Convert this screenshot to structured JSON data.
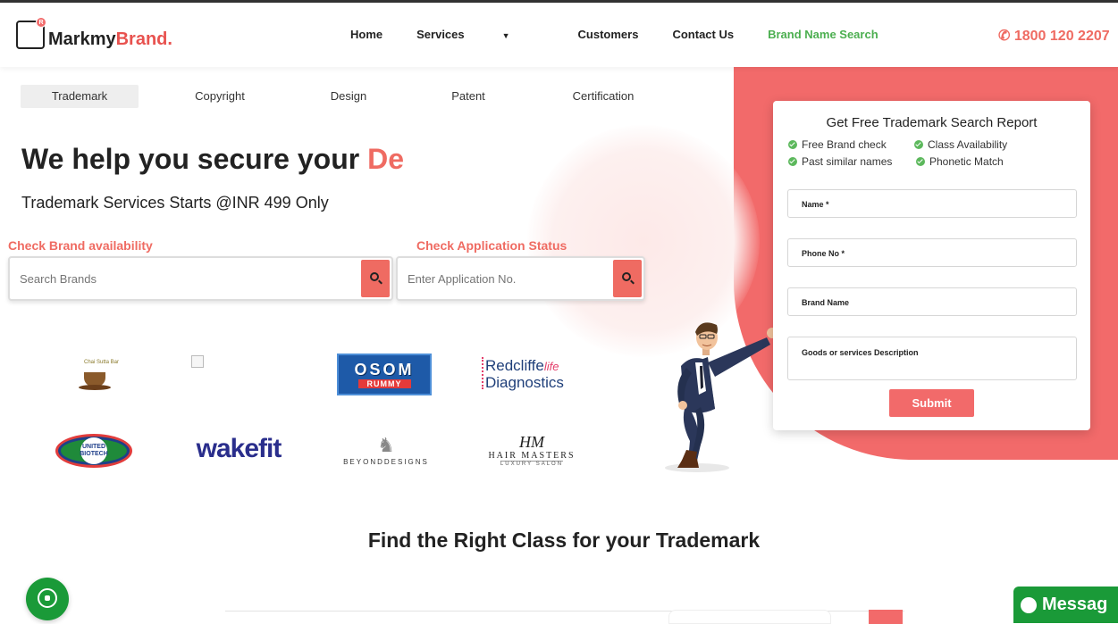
{
  "brand": {
    "logo_main": "Markmy",
    "logo_accent": "Brand.",
    "logo_badge": "R"
  },
  "nav": {
    "home": "Home",
    "services": "Services",
    "customers": "Customers",
    "contact": "Contact Us",
    "brand_search": "Brand Name Search"
  },
  "phone": "1800 120 2207",
  "tabs": [
    "Trademark",
    "Copyright",
    "Design",
    "Patent",
    "Certification"
  ],
  "hero": {
    "headline": "We help you secure your ",
    "headline_accent": "De",
    "subline": "Trademark Services Starts @INR 499 Only"
  },
  "search_brand": {
    "label": "Check Brand availability",
    "placeholder": "Search Brands"
  },
  "search_app": {
    "label": "Check Application Status",
    "placeholder": "Enter Application No."
  },
  "logos": {
    "chai_tag": "Chai Sutta Bar",
    "osom_top": "OSOM",
    "osom_bottom": "RUMMY",
    "redcliffe_1": "Redcliffe",
    "redcliffe_life": "life",
    "redcliffe_2": "Diagnostics",
    "united_biotech": "UNITED BIOTECH",
    "wakefit": "wakefit",
    "beyond": "BEYONDDESIGNS",
    "hair_mono": "HM",
    "hair_title": "HAIR MASTERS",
    "hair_sub": "LUXURY SALON"
  },
  "form": {
    "title": "Get Free Trademark Search Report",
    "features": [
      "Free Brand check",
      "Class Availability",
      "Past similar names",
      "Phonetic Match"
    ],
    "name": "Name *",
    "phone": "Phone No *",
    "brand": "Brand Name",
    "goods": "Goods or services Description",
    "submit": "Submit"
  },
  "section_title": "Find the Right Class for your Trademark",
  "chat": {
    "message": "Messag"
  },
  "colors": {
    "accent": "#ef6b62",
    "green": "#4caf50",
    "whatsapp": "#1a9a38"
  }
}
